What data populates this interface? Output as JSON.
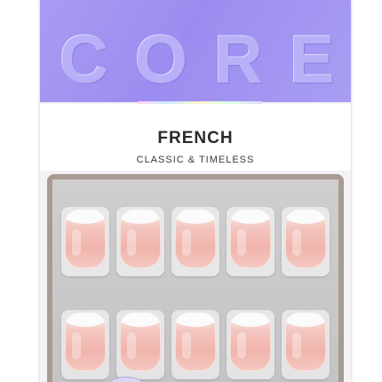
{
  "package": {
    "brand": "CORE",
    "product_title": "FRENCH",
    "product_subtitle": "CLASSIC & TIMELESS"
  },
  "tray": {
    "rows": 2,
    "nails_per_row": 5
  },
  "colors": {
    "header": "#9c8cf0",
    "nail_pink": "#f0b4ac",
    "nail_tip": "#fbfbfb",
    "tray": "#c8c7c9"
  }
}
